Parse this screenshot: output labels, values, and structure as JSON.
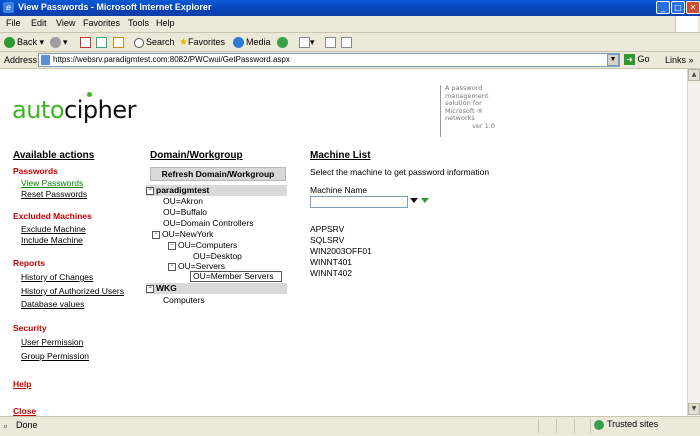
{
  "window": {
    "title": "View Passwords - Microsoft Internet Explorer"
  },
  "menu": [
    "File",
    "Edit",
    "View",
    "Favorites",
    "Tools",
    "Help"
  ],
  "toolbar": {
    "back": "Back",
    "search": "Search",
    "favorites": "Favorites",
    "media": "Media"
  },
  "address": {
    "label": "Address",
    "url": "https://websrv.paradigmtest.com:8082/PWCwui/GetPassword.aspx",
    "go": "Go",
    "links": "Links"
  },
  "logo": {
    "part1": "auto",
    "part2": "cipher"
  },
  "tagline": {
    "lines": [
      "A password",
      "management",
      "solution for",
      "Microsoft ®",
      "networks"
    ],
    "version": "ver 1.0"
  },
  "left": {
    "heading": "Available actions",
    "passwords": {
      "label": "Passwords",
      "view": "View Passwords",
      "reset": "Reset Passwords"
    },
    "excluded": {
      "label": "Excluded Machines",
      "exclude": "Exclude Machine",
      "include": "Include Machine"
    },
    "reports": {
      "label": "Reports",
      "changes": "History of Changes",
      "authorized": "History of Authorized Users",
      "db": "Database values"
    },
    "security": {
      "label": "Security",
      "user": "User Permission",
      "group": "Group Permission"
    },
    "help": "Help",
    "close": "Close"
  },
  "domain": {
    "heading": "Domain/Workgroup",
    "refresh": "Refresh Domain/Workgroup",
    "root1": "paradigmtest",
    "items": [
      "OU=Akron",
      "OU=Buffalo",
      "OU=Domain Controllers",
      "OU=NewYork",
      "OU=Computers",
      "OU=Desktop",
      "OU=Servers",
      "OU=Member Servers"
    ],
    "root2": "WKG",
    "root2child": "Computers"
  },
  "machines": {
    "heading": "Machine List",
    "instruction": "Select the machine to get password information",
    "name_label": "Machine Name",
    "name_value": "",
    "list": [
      "APPSRV",
      "SQLSRV",
      "WIN2003OFF01",
      "WINNT401",
      "WINNT402"
    ]
  },
  "status": {
    "text": "Done",
    "zone": "Trusted sites"
  },
  "colors": {
    "titlebar": "#0843b7",
    "accent_green": "#3cb523",
    "category_red": "#cc0000",
    "link_visited": "#008000"
  }
}
